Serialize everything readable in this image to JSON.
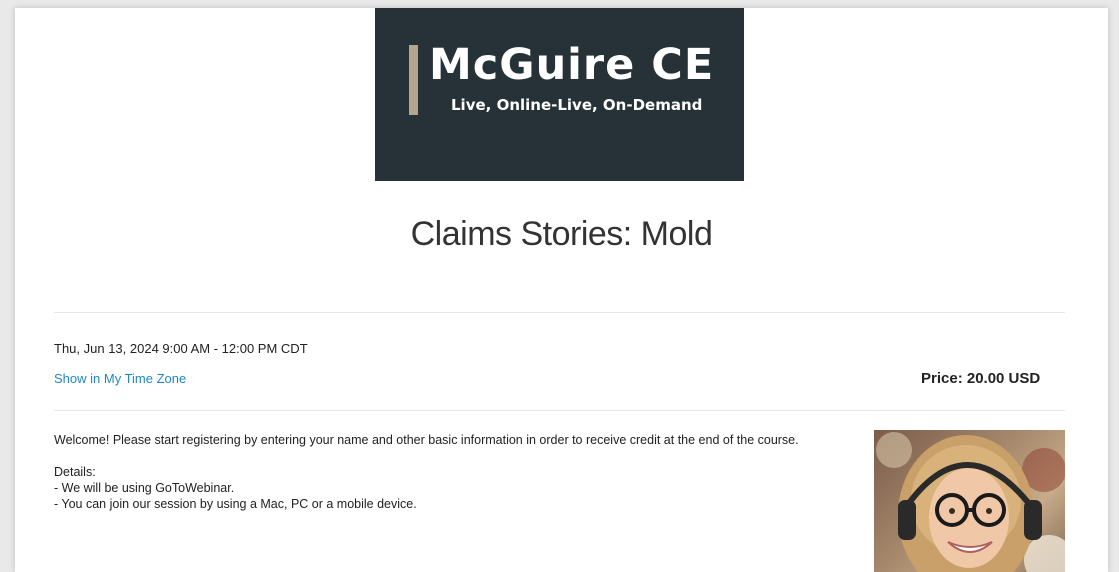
{
  "logo": {
    "title": "McGuire CE",
    "subtitle": "Live, Online-Live, On-Demand",
    "accent_color": "#b5a48f",
    "background_color": "#263238"
  },
  "event": {
    "title": "Claims Stories: Mold",
    "datetime": "Thu, Jun 13, 2024 9:00 AM - 12:00 PM CDT",
    "timezone_link": "Show in My Time Zone",
    "price": "Price: 20.00 USD"
  },
  "description": {
    "welcome": "Welcome! Please start registering by entering your name and other basic information in order to receive credit at the end of the course.",
    "details_heading": "Details:",
    "details": [
      "- We will be using GoToWebinar.",
      "- You can join our session by using a Mac, PC or a mobile device."
    ]
  },
  "colors": {
    "link": "#1e88c7"
  }
}
